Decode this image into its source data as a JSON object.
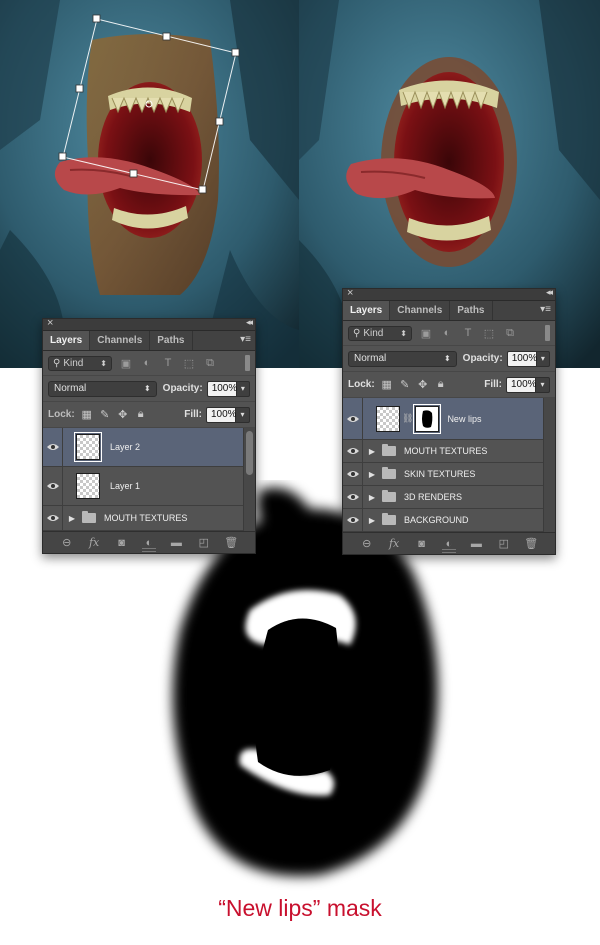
{
  "colors": {
    "accent": "#c8102e",
    "panel_bg": "#535353",
    "selected_layer": "#5a6478"
  },
  "left_panel": {
    "tabs": [
      "Layers",
      "Channels",
      "Paths"
    ],
    "active_tab": "Layers",
    "kind_label": "Kind",
    "blend_mode": "Normal",
    "opacity_label": "Opacity:",
    "opacity_value": "100%",
    "lock_label": "Lock:",
    "fill_label": "Fill:",
    "fill_value": "100%",
    "layers": [
      {
        "name": "Layer 2",
        "type": "pixel",
        "selected": true
      },
      {
        "name": "Layer 1",
        "type": "pixel",
        "selected": false
      },
      {
        "name": "MOUTH TEXTURES",
        "type": "group",
        "selected": false
      }
    ]
  },
  "right_panel": {
    "tabs": [
      "Layers",
      "Channels",
      "Paths"
    ],
    "active_tab": "Layers",
    "kind_label": "Kind",
    "blend_mode": "Normal",
    "opacity_label": "Opacity:",
    "opacity_value": "100%",
    "lock_label": "Lock:",
    "fill_label": "Fill:",
    "fill_value": "100%",
    "layers": [
      {
        "name": "New lips",
        "type": "pixel-with-mask",
        "selected": true
      },
      {
        "name": "MOUTH TEXTURES",
        "type": "group",
        "selected": false
      },
      {
        "name": "SKIN TEXTURES",
        "type": "group",
        "selected": false
      },
      {
        "name": "3D RENDERS",
        "type": "group",
        "selected": false
      },
      {
        "name": "BACKGROUND",
        "type": "group",
        "selected": false
      }
    ]
  },
  "icons": {
    "close": "close-icon",
    "collapse": "collapse-icon",
    "panel_menu": "panel-menu-icon",
    "eye": "eye-icon",
    "folder": "folder-icon",
    "link": "link-layers-icon",
    "fx": "fx-icon",
    "mask": "add-mask-icon",
    "adjustment": "adjustment-layer-icon",
    "group": "new-group-icon",
    "new_layer": "new-layer-icon",
    "trash": "trash-icon"
  },
  "caption": "“New lips” mask"
}
